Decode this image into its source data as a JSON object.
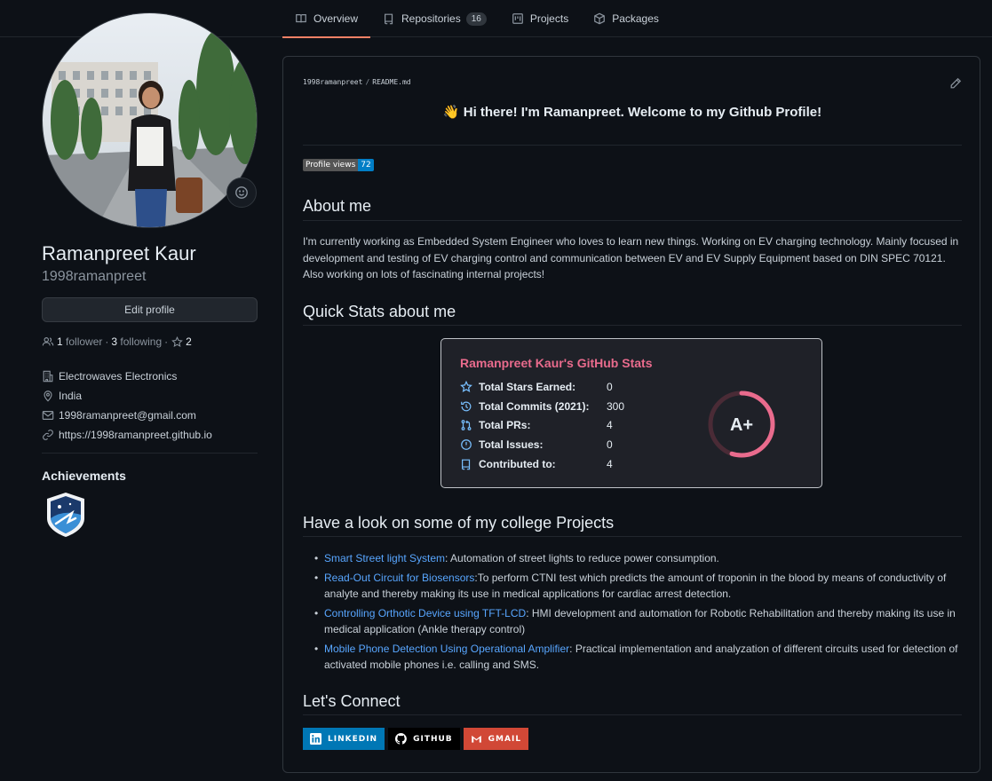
{
  "tabs": [
    {
      "label": "Overview",
      "icon": "book-icon"
    },
    {
      "label": "Repositories",
      "icon": "repo-icon",
      "count": "16"
    },
    {
      "label": "Projects",
      "icon": "project-icon"
    },
    {
      "label": "Packages",
      "icon": "package-icon"
    }
  ],
  "profile": {
    "full_name": "Ramanpreet Kaur",
    "username": "1998ramanpreet",
    "edit_label": "Edit profile",
    "followers_count": "1",
    "followers_label": "follower",
    "separator": "·",
    "following_count": "3",
    "following_label": "following",
    "stars_count": "2",
    "company": "Electrowaves Electronics",
    "location": "India",
    "email": "1998ramanpreet@gmail.com",
    "website": "https://1998ramanpreet.github.io",
    "achievements_title": "Achievements"
  },
  "readme": {
    "path_user": "1998ramanpreet",
    "path_sep": "/",
    "path_file": "README.md",
    "greeting": "👋 Hi there! I'm Ramanpreet. Welcome to my Github Profile!",
    "views_label": "Profile views",
    "views_count": "72",
    "about_title": "About me",
    "about_text": "I'm currently working as Embedded System Engineer who loves to learn new things. Working on EV charging technology. Mainly focused in development and testing of EV charging control and communication between EV and EV Supply Equipment based on DIN SPEC 70121. Also working on lots of fascinating internal projects!",
    "stats_title": "Quick Stats about me",
    "projects_title": "Have a look on some of my college Projects",
    "projects": [
      {
        "name": "Smart Street light System",
        "desc": ": Automation of street lights to reduce power consumption."
      },
      {
        "name": "Read-Out Circuit for Biosensors",
        "desc": ":To perform CTNI test which predicts the amount of troponin in the blood by means of conductivity of analyte and thereby making its use in medical applications for cardiac arrest detection."
      },
      {
        "name": "Controlling Orthotic Device using TFT-LCD",
        "desc": ": HMI development and automation for Robotic Rehabilitation and thereby making its use in medical application (Ankle therapy control)"
      },
      {
        "name": "Mobile Phone Detection Using Operational Amplifier",
        "desc": ": Practical implementation and analyzation of different circuits used for detection of activated mobile phones i.e. calling and SMS."
      }
    ],
    "connect_title": "Let's Connect",
    "connect": [
      {
        "label": "LINKEDIN",
        "color": "#0077b5",
        "icon": "linkedin-icon"
      },
      {
        "label": "GITHUB",
        "color": "#000000",
        "icon": "github-icon"
      },
      {
        "label": "GMAIL",
        "color": "#d14836",
        "icon": "gmail-icon"
      }
    ]
  },
  "stats_card": {
    "title": "Ramanpreet Kaur's GitHub Stats",
    "rows": [
      {
        "label": "Total Stars Earned:",
        "value": "0",
        "icon": "star-icon"
      },
      {
        "label": "Total Commits (2021):",
        "value": "300",
        "icon": "history-icon"
      },
      {
        "label": "Total PRs:",
        "value": "4",
        "icon": "pull-request-icon"
      },
      {
        "label": "Total Issues:",
        "value": "0",
        "icon": "issue-icon"
      },
      {
        "label": "Contributed to:",
        "value": "4",
        "icon": "repo-icon"
      }
    ],
    "rank": "A+",
    "rank_progress": 0.55,
    "accent": "#e96b8d"
  }
}
